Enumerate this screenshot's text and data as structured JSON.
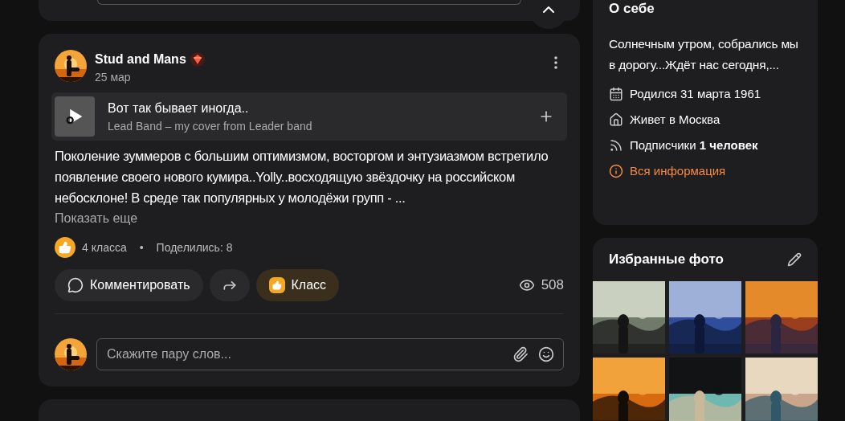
{
  "post": {
    "author": "Stud and Mans",
    "date": "25 мар",
    "track": {
      "title": "Вот так бывает иногда..",
      "subtitle": "Lead Band – my cover from Leader band"
    },
    "text": "Поколение зуммеров с большим оптимизмом, восторгом и энтузиазмом встретило появление своего нового кумира..Yolly..восходящую звёздочку на российском небосклоне! В среде так популярных у молодёжи групп - ...",
    "show_more": "Показать еще",
    "likes": "4 класса",
    "separator": "•",
    "shares": "Поделились: 8",
    "actions": [
      {
        "kind": "comment",
        "label": "Комментировать"
      },
      {
        "kind": "share"
      },
      {
        "kind": "like",
        "label": "Класс"
      }
    ],
    "views": "508",
    "comment_placeholder": "Скажите пару слов..."
  },
  "about": {
    "title": "О себе",
    "text": "Солнечным утром, собрались мы в дорогу...Ждёт нас сегодня,...",
    "facts": [
      {
        "kind": "birthday",
        "text": "Родился 31 марта 1961"
      },
      {
        "kind": "home",
        "text": "Живет в Москва"
      },
      {
        "kind": "followers",
        "text": "Подписчики",
        "bold": "1 человек"
      },
      {
        "kind": "info",
        "text": "Вся информация"
      }
    ]
  },
  "photos": {
    "title": "Избранные фото"
  }
}
